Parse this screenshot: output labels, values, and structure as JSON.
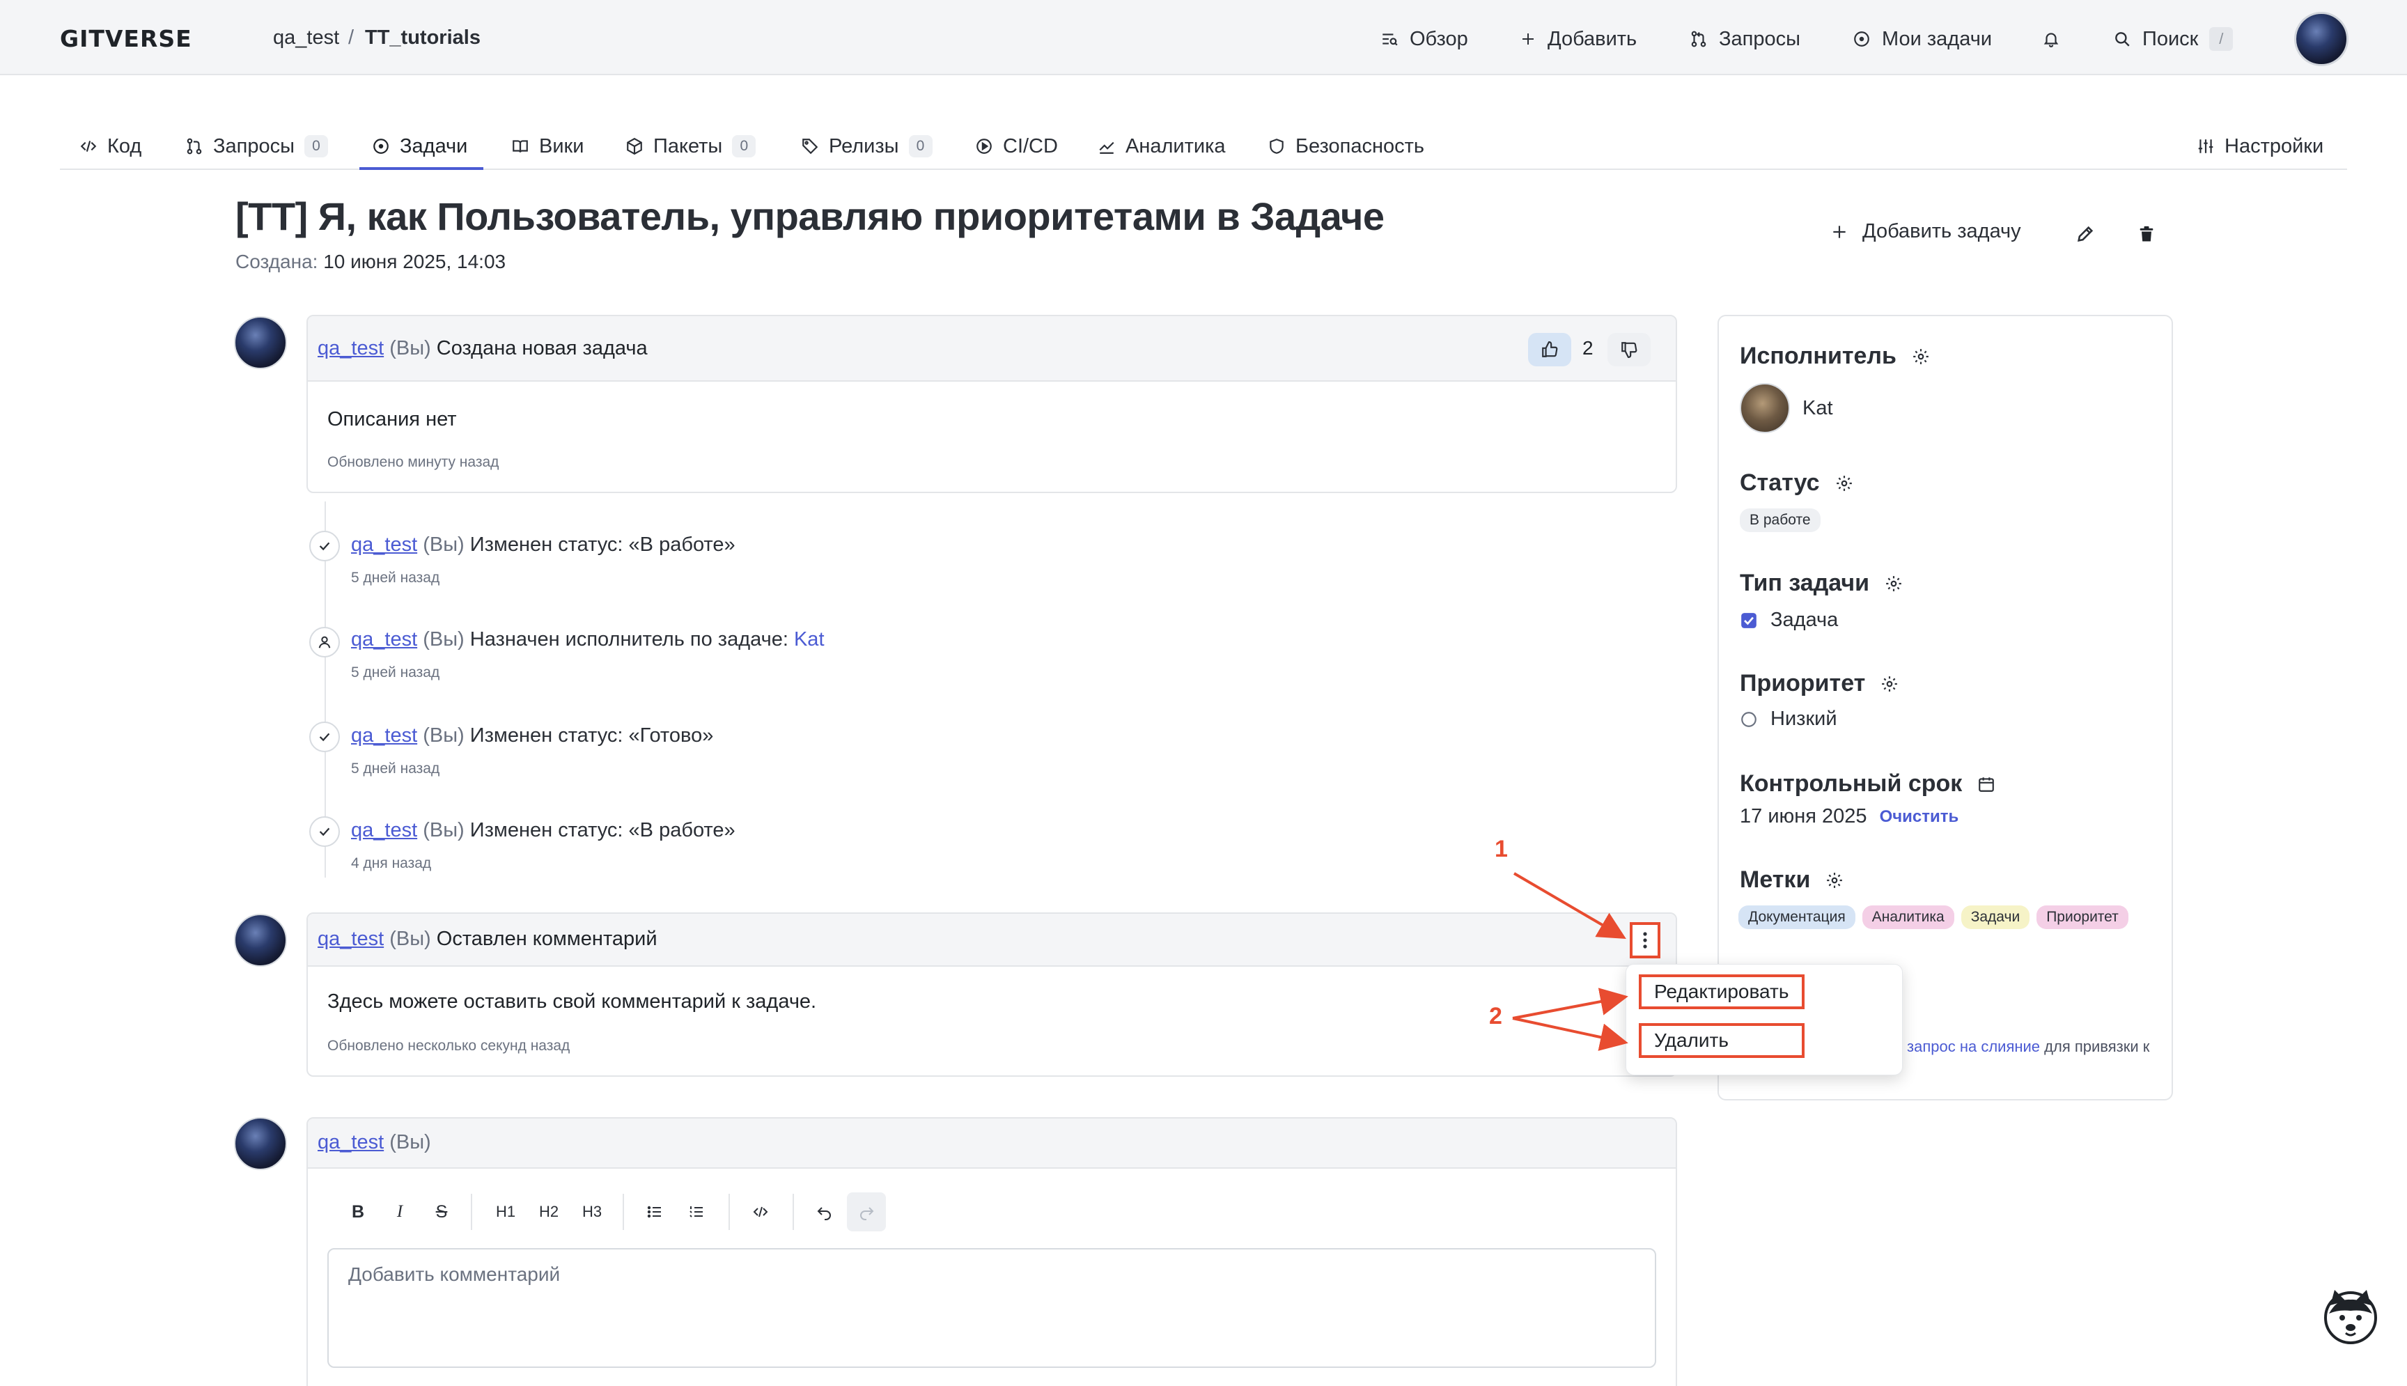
{
  "header": {
    "logo": "GITVERSE",
    "breadcrumb": [
      "qa_test",
      "TT_tutorials"
    ],
    "breadcrumb_sep": "/",
    "nav": [
      "Обзор",
      "Добавить",
      "Запросы",
      "Мои задачи"
    ],
    "search_label": "Поиск",
    "search_shortcut": "/"
  },
  "tabs": [
    {
      "label": "Код",
      "icon": "code-icon"
    },
    {
      "label": "Запросы",
      "icon": "pull-request-icon",
      "count": "0"
    },
    {
      "label": "Задачи",
      "icon": "issue-icon",
      "active": true
    },
    {
      "label": "Вики",
      "icon": "book-icon"
    },
    {
      "label": "Пакеты",
      "icon": "package-icon",
      "count": "0"
    },
    {
      "label": "Релизы",
      "icon": "tag-icon",
      "count": "0"
    },
    {
      "label": "CI/CD",
      "icon": "play-icon"
    },
    {
      "label": "Аналитика",
      "icon": "graph-icon"
    },
    {
      "label": "Безопасность",
      "icon": "shield-icon"
    }
  ],
  "settings_label": "Настройки",
  "issue": {
    "title": "[TT] Я, как Пользователь, управляю приоритетами в Задаче",
    "created_label": "Создана:",
    "created_value": "10 июня 2025, 14:03",
    "add_task_label": "Добавить задачу"
  },
  "description_card": {
    "user": "qa_test",
    "you": "(Вы)",
    "action": "Создана новая задача",
    "likes": "2",
    "body": "Описания нет",
    "updated": "Обновлено минуту назад"
  },
  "timeline": [
    {
      "user": "qa_test",
      "you": "(Вы)",
      "text": "Изменен статус: «В работе»",
      "time": "5 дней назад",
      "icon": "check-icon"
    },
    {
      "user": "qa_test",
      "you": "(Вы)",
      "text": "Назначен исполнитель по задаче:",
      "assignee": "Kat",
      "time": "5 дней назад",
      "icon": "person-icon"
    },
    {
      "user": "qa_test",
      "you": "(Вы)",
      "text": "Изменен статус: «Готово»",
      "time": "5 дней назад",
      "icon": "check-icon"
    },
    {
      "user": "qa_test",
      "you": "(Вы)",
      "text": "Изменен статус: «В работе»",
      "time": "4 дня назад",
      "icon": "check-icon"
    }
  ],
  "comment_card": {
    "user": "qa_test",
    "you": "(Вы)",
    "action": "Оставлен комментарий",
    "body": "Здесь можете оставить свой комментарий к задаче.",
    "updated": "Обновлено несколько секунд назад"
  },
  "dropdown": {
    "items": [
      "Редактировать",
      "Удалить"
    ]
  },
  "annotations": {
    "marker_1": "1",
    "marker_2": "2",
    "color": "#e84c30"
  },
  "new_comment": {
    "user": "qa_test",
    "you": "(Вы)",
    "toolbar": [
      "B",
      "I",
      "S",
      "H1",
      "H2",
      "H3"
    ],
    "placeholder": "Добавить комментарий"
  },
  "sidebar": {
    "assignee_title": "Исполнитель",
    "assignee": "Kat",
    "status_title": "Статус",
    "status": "В работе",
    "type_title": "Тип задачи",
    "type": "Задача",
    "priority_title": "Приоритет",
    "priority": "Низкий",
    "deadline_title": "Контрольный срок",
    "deadline": "17 июня 2025",
    "clear_label": "Очистить",
    "labels_title": "Метки",
    "labels": [
      {
        "name": "Документация",
        "color": "#d6e4f5"
      },
      {
        "name": "Аналитика",
        "color": "#f4cfe6"
      },
      {
        "name": "Задачи",
        "color": "#f6f3c7"
      },
      {
        "name": "Приоритет",
        "color": "#f4cfe6"
      }
    ],
    "merge_link": "запрос на слияние",
    "merge_text": "для привязки к"
  },
  "colors": {
    "accent": "#4b5bd3",
    "annotation": "#e84c30"
  }
}
